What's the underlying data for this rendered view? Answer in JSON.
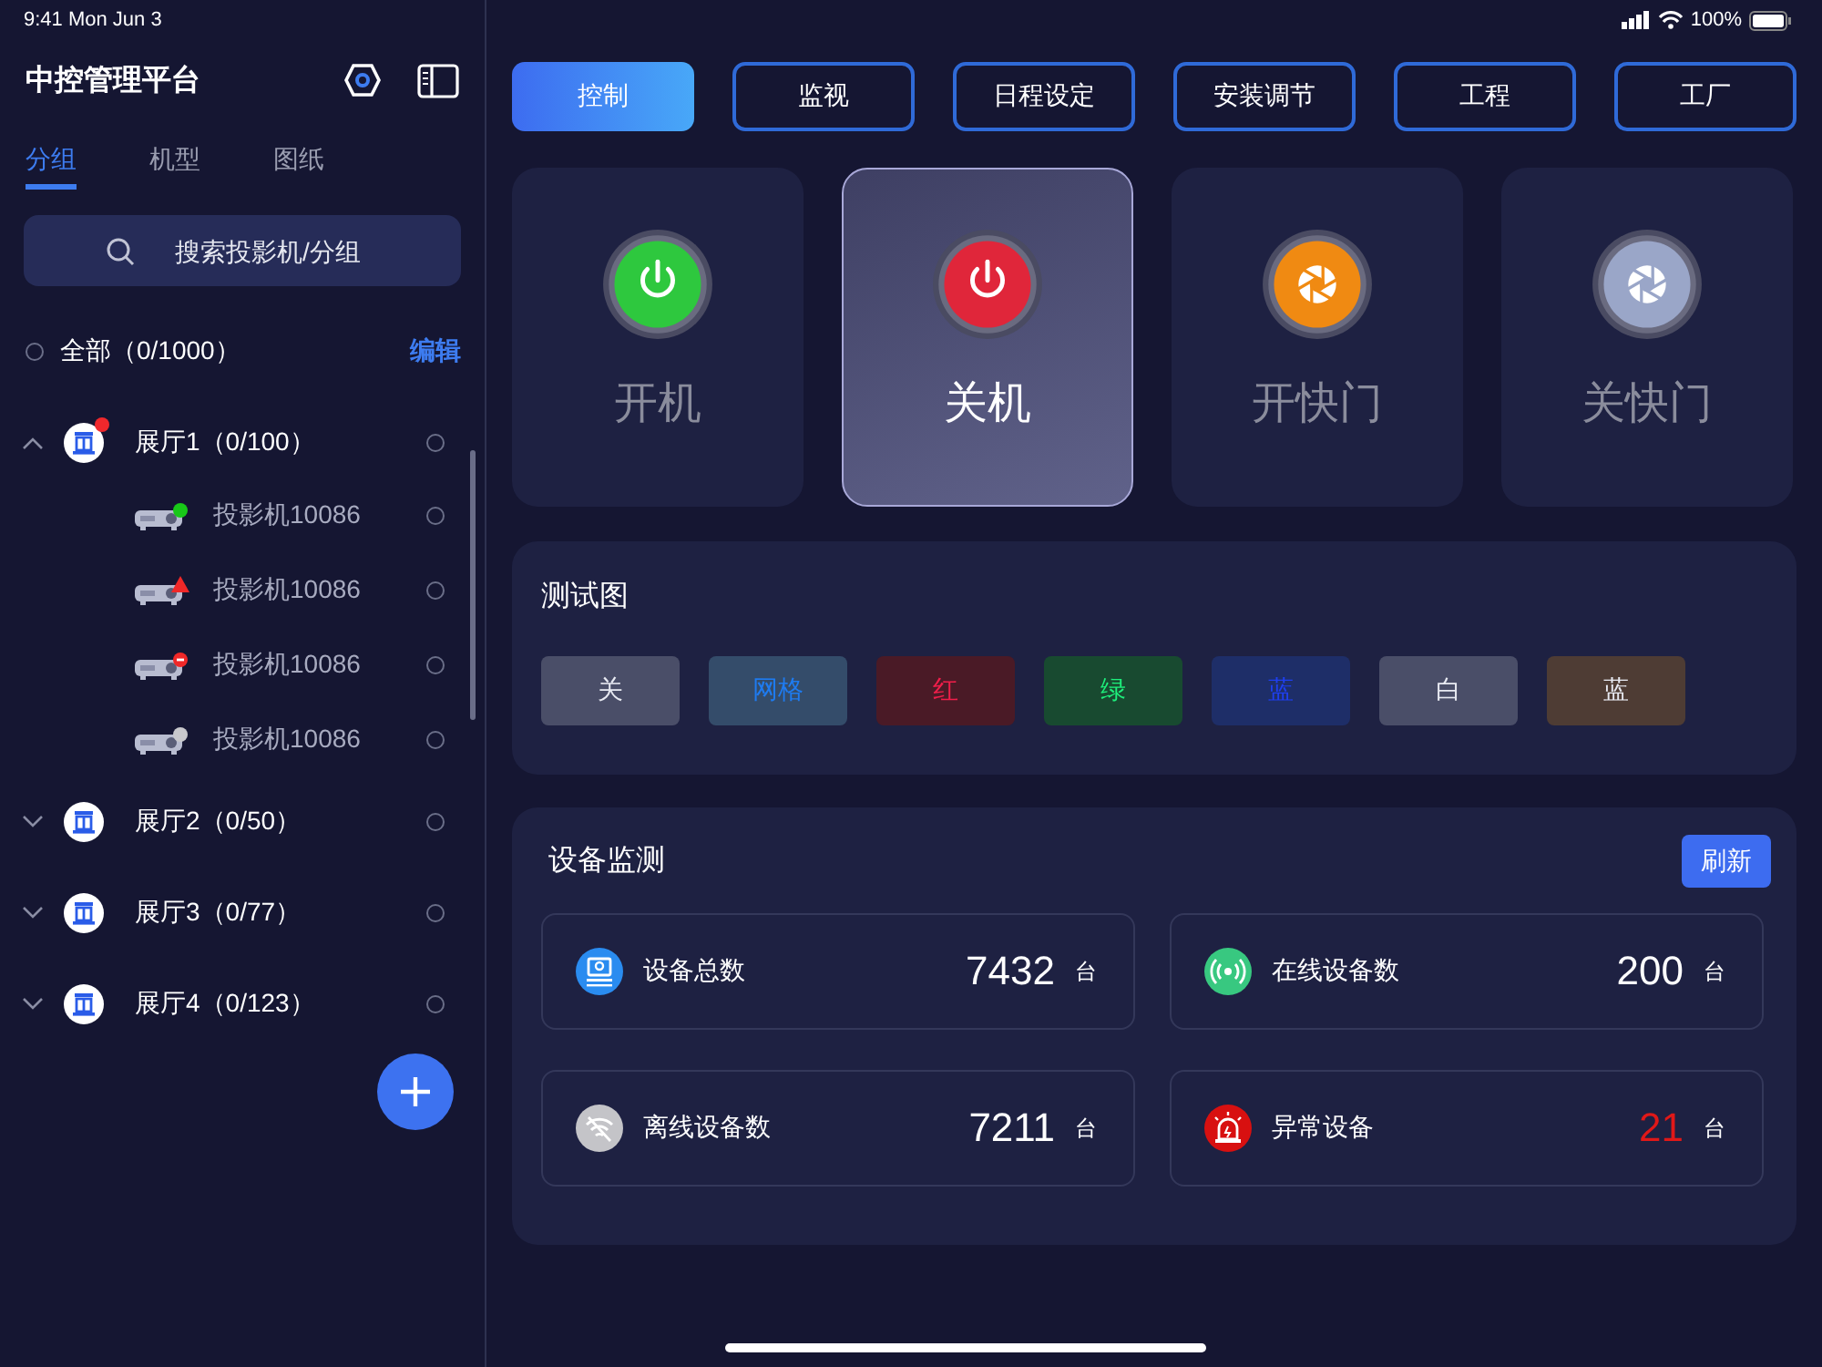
{
  "status_bar": {
    "time": "9:41 Mon Jun 3",
    "battery": "100%"
  },
  "sidebar": {
    "title": "中控管理平台",
    "tabs": [
      {
        "label": "分组",
        "selected": true
      },
      {
        "label": "机型",
        "selected": false
      },
      {
        "label": "图纸",
        "selected": false
      }
    ],
    "search": {
      "placeholder": "搜索投影机/分组"
    },
    "all_row": {
      "label": "全部（0/1000）",
      "checked": false,
      "edit": "编辑"
    },
    "groups": [
      {
        "label": "展厅1（0/100）",
        "expanded": true,
        "alert": true,
        "checked": false,
        "children": [
          {
            "label": "投影机10086",
            "kind": "online",
            "checked": false
          },
          {
            "label": "投影机10086",
            "kind": "warning",
            "checked": false
          },
          {
            "label": "投影机10086",
            "kind": "error",
            "checked": false
          },
          {
            "label": "投影机10086",
            "kind": "offline",
            "checked": false
          }
        ]
      },
      {
        "label": "展厅2（0/50）",
        "expanded": false,
        "alert": false,
        "checked": false
      },
      {
        "label": "展厅3（0/77）",
        "expanded": false,
        "alert": false,
        "checked": false
      },
      {
        "label": "展厅4（0/123）",
        "expanded": false,
        "alert": false,
        "checked": false
      }
    ]
  },
  "top_tabs": [
    {
      "label": "控制",
      "selected": true
    },
    {
      "label": "监视",
      "selected": false
    },
    {
      "label": "日程设定",
      "selected": false
    },
    {
      "label": "安装调节",
      "selected": false
    },
    {
      "label": "工程",
      "selected": false
    },
    {
      "label": "工厂",
      "selected": false
    }
  ],
  "actions": [
    {
      "label": "开机",
      "kind": "power",
      "color": "#2ec83e",
      "selected": false
    },
    {
      "label": "关机",
      "kind": "power",
      "color": "#e0263a",
      "selected": true
    },
    {
      "label": "开快门",
      "kind": "shutter",
      "color": "#f08a12",
      "selected": false
    },
    {
      "label": "关快门",
      "kind": "shutter",
      "color": "#9aa6c8",
      "selected": false
    }
  ],
  "test_pattern": {
    "title": "测试图",
    "buttons": [
      {
        "label": "关",
        "color": "#4a4e68"
      },
      {
        "label": "网格",
        "color": "#344c6a"
      },
      {
        "label": "红",
        "color": "#4a1a26"
      },
      {
        "label": "绿",
        "color": "#184a30"
      },
      {
        "label": "蓝",
        "color": "#1e2e68"
      },
      {
        "label": "白",
        "color": "#4a4e68"
      },
      {
        "label": "蓝",
        "color": "#4e3c34"
      }
    ]
  },
  "monitor": {
    "title": "设备监测",
    "refresh": "刷新",
    "stats": [
      {
        "kind": "total",
        "label": "设备总数",
        "value": "7432",
        "unit": "台"
      },
      {
        "kind": "online",
        "label": "在线设备数",
        "value": "200",
        "unit": "台"
      },
      {
        "kind": "offline",
        "label": "离线设备数",
        "value": "7211",
        "unit": "台"
      },
      {
        "kind": "alert",
        "label": "异常设备",
        "value": "21",
        "unit": "台"
      }
    ]
  }
}
